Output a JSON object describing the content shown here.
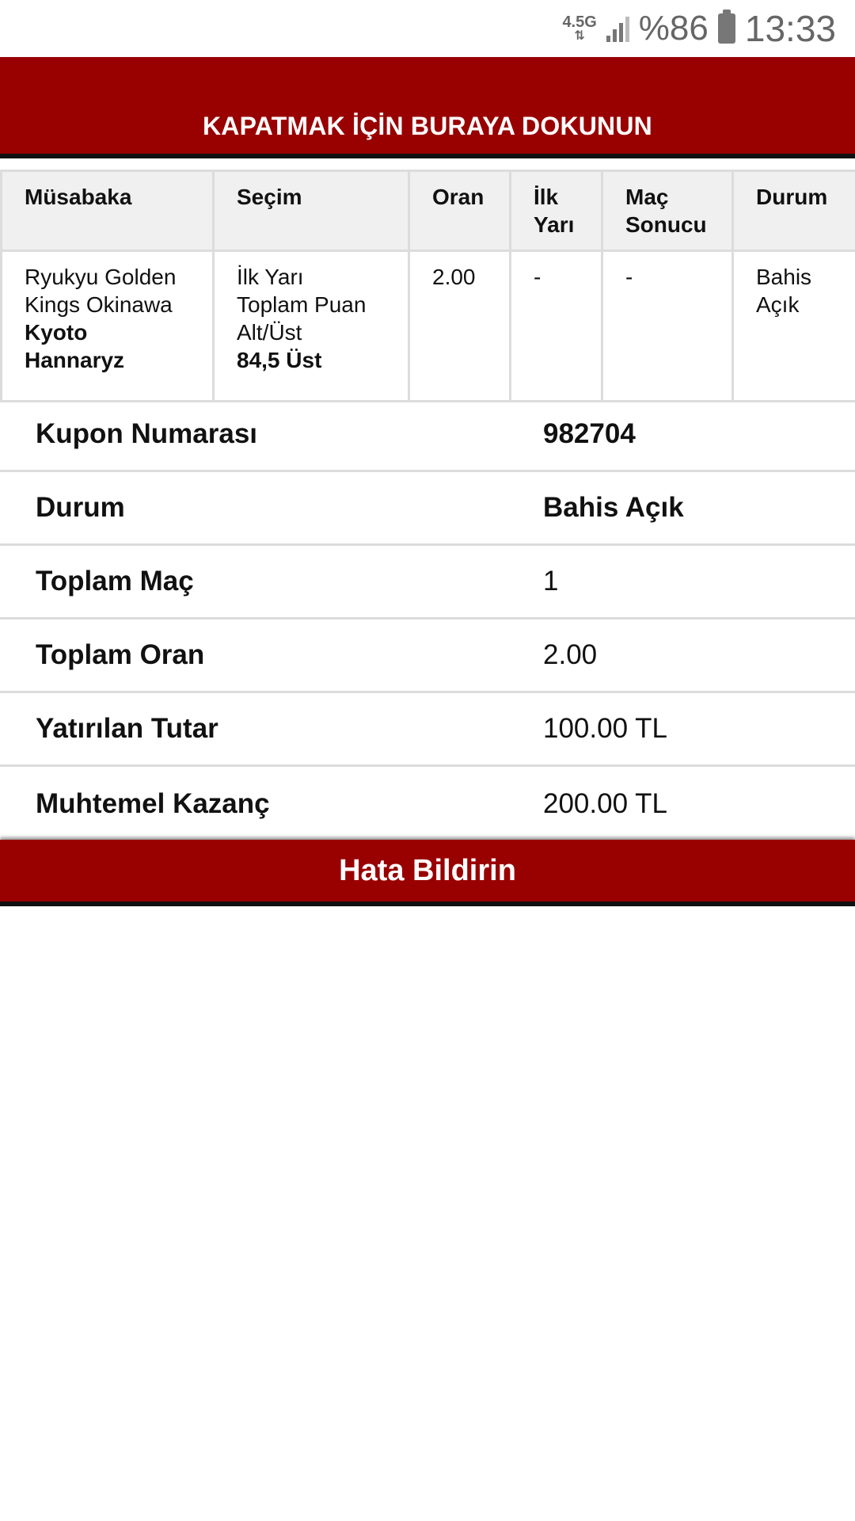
{
  "status_bar": {
    "network": "4.5G",
    "battery": "%86",
    "time": "13:33"
  },
  "close_banner": "KAPATMAK İÇİN BURAYA DOKUNUN",
  "table": {
    "headers": {
      "match": "Müsabaka",
      "selection": "Seçim",
      "odds": "Oran",
      "first_half_1": "İlk",
      "first_half_2": "Yarı",
      "result_1": "Maç",
      "result_2": "Sonucu",
      "status": "Durum"
    },
    "row": {
      "team1_a": "Ryukyu Golden",
      "team1_b": "Kings Okinawa",
      "team2_a": "Kyoto",
      "team2_b": "Hannaryz",
      "sel_a": "İlk Yarı",
      "sel_b": "Toplam Puan",
      "sel_c": "Alt/Üst",
      "sel_d": "84,5 Üst",
      "odds": "2.00",
      "first_half": "-",
      "result": "-",
      "status_a": "Bahis",
      "status_b": "Açık"
    }
  },
  "summary": {
    "coupon_label": "Kupon Numarası",
    "coupon_value": "982704",
    "status_label": "Durum",
    "status_value": "Bahis Açık",
    "total_matches_label": "Toplam Maç",
    "total_matches_value": "1",
    "total_odds_label": "Toplam Oran",
    "total_odds_value": "2.00",
    "stake_label": "Yatırılan Tutar",
    "stake_value": "100.00 TL",
    "win_label": "Muhtemel Kazanç",
    "win_value": "200.00 TL"
  },
  "report_button": "Hata Bildirin",
  "colors": {
    "brand_red": "#990000",
    "header_bg": "#f0f0f0",
    "border": "#dcdcdc"
  }
}
